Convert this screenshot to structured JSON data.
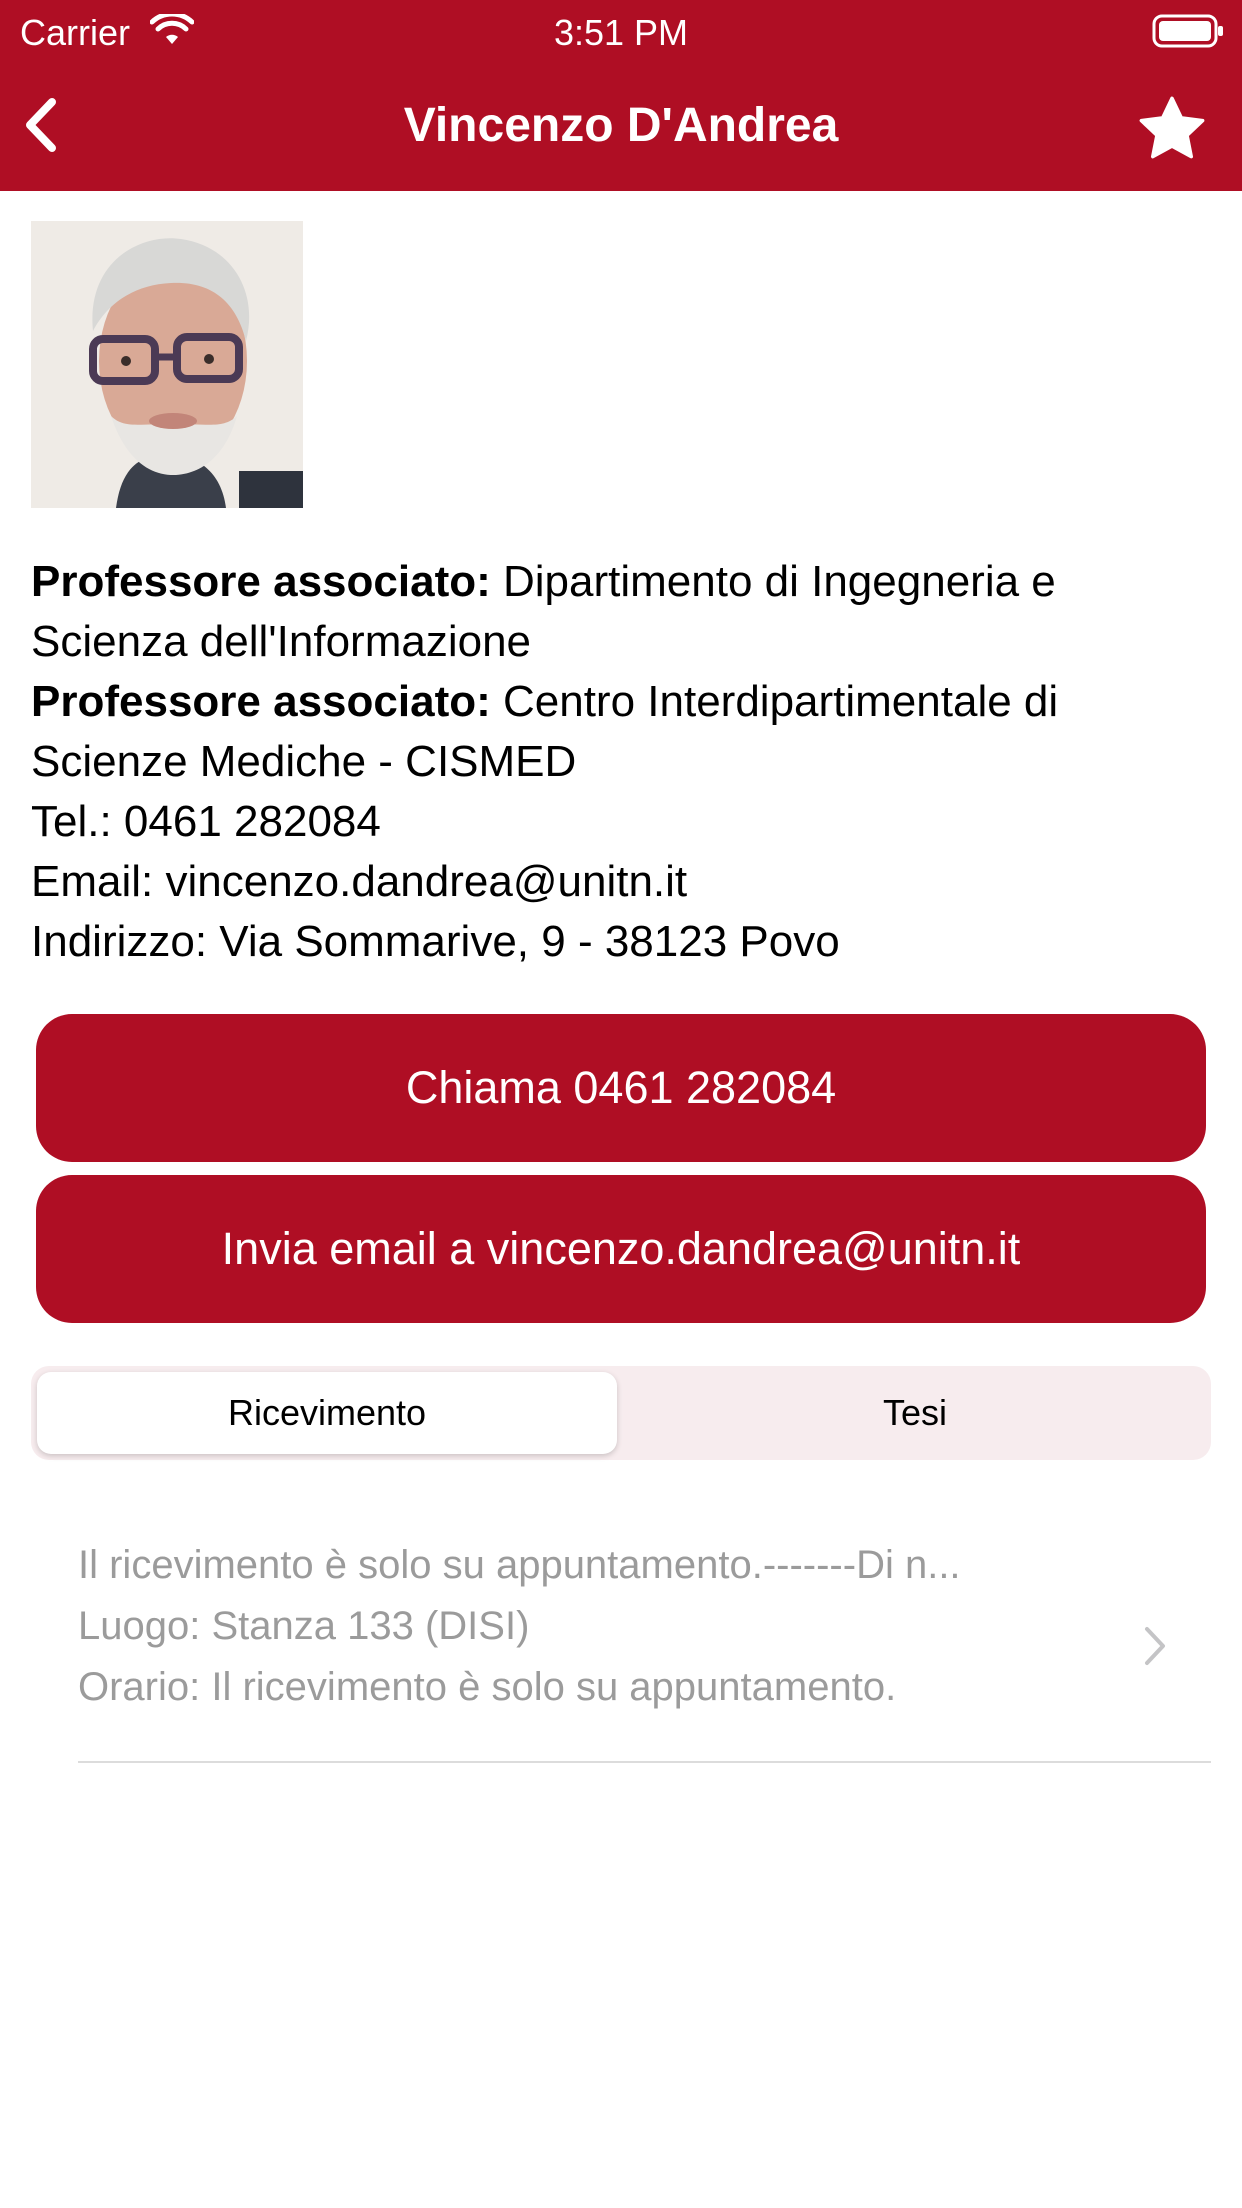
{
  "status_bar": {
    "carrier": "Carrier",
    "time": "3:51 PM"
  },
  "nav": {
    "title": "Vincenzo D'Andrea",
    "back_icon": "chevron-left-icon",
    "favorite_icon": "star-icon"
  },
  "colors": {
    "brand": "#AF0E24",
    "secondary_text": "#9b9b9b",
    "segment_bg": "#f7ecee"
  },
  "profile": {
    "roles": [
      {
        "role": "Professore associato:",
        "department": "Dipartimento di Ingegneria e"
      },
      {
        "role": "Professore associato:",
        "department": "Centro Interdipartimentale di"
      }
    ],
    "role_continuations": [
      "Scienza dell'Informazione",
      "Scienze Mediche - CISMED"
    ],
    "phone_line": "Tel.: 0461 282084",
    "email_line": "Email: vincenzo.dandrea@unitn.it",
    "address_line": "Indirizzo: Via Sommarive, 9 - 38123 Povo"
  },
  "actions": {
    "call_label": "Chiama 0461 282084",
    "email_label": "Invia email a vincenzo.dandrea@unitn.it"
  },
  "tabs": [
    {
      "label": "Ricevimento",
      "selected": true
    },
    {
      "label": "Tesi",
      "selected": false
    }
  ],
  "ricevimento": {
    "items": [
      {
        "notes": "Il ricevimento è solo su appuntamento.-------Di n...",
        "location": "Luogo: Stanza 133 (DISI)",
        "schedule": "Orario: Il ricevimento è solo su appuntamento."
      }
    ]
  }
}
